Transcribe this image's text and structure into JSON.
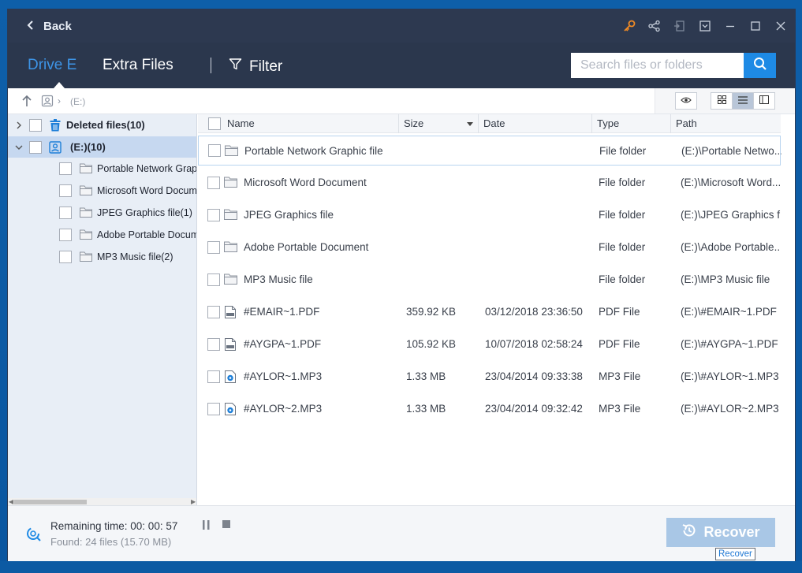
{
  "titlebar": {
    "back_label": "Back",
    "icons": [
      "key-icon",
      "share-icon",
      "exit-icon",
      "menu-dropdown-icon",
      "minimize-icon",
      "maximize-icon",
      "close-icon"
    ]
  },
  "tabs": [
    {
      "label": "Drive E",
      "active": true
    },
    {
      "label": "Extra Files",
      "active": false
    }
  ],
  "filter_label": "Filter",
  "search": {
    "placeholder": "Search files or folders",
    "value": ""
  },
  "breadcrumb": {
    "path": "(E:)"
  },
  "tree": {
    "items": [
      {
        "label": "Deleted files(10)",
        "expanded": false,
        "level": 0,
        "icon": "trash-icon"
      },
      {
        "label": "(E:)(10)",
        "expanded": true,
        "level": 0,
        "icon": "drive-icon",
        "selected": true
      },
      {
        "label": "Portable Network Graph",
        "level": 1,
        "icon": "folder-icon"
      },
      {
        "label": "Microsoft Word Docume",
        "level": 1,
        "icon": "folder-icon"
      },
      {
        "label": "JPEG Graphics file(1)",
        "level": 1,
        "icon": "folder-icon"
      },
      {
        "label": "Adobe Portable Docume",
        "level": 1,
        "icon": "folder-icon"
      },
      {
        "label": "MP3 Music file(2)",
        "level": 1,
        "icon": "folder-icon"
      }
    ]
  },
  "columns": {
    "name": "Name",
    "size": "Size",
    "date": "Date",
    "type": "Type",
    "path": "Path"
  },
  "files": [
    {
      "name": "Portable Network Graphic file",
      "size": "",
      "date": "",
      "type": "File folder",
      "path": "(E:)\\Portable Netwo...",
      "icon": "folder-icon"
    },
    {
      "name": "Microsoft Word Document",
      "size": "",
      "date": "",
      "type": "File folder",
      "path": "(E:)\\Microsoft Word...",
      "icon": "folder-icon"
    },
    {
      "name": "JPEG Graphics file",
      "size": "",
      "date": "",
      "type": "File folder",
      "path": "(E:)\\JPEG Graphics f...",
      "icon": "folder-icon"
    },
    {
      "name": "Adobe Portable Document",
      "size": "",
      "date": "",
      "type": "File folder",
      "path": "(E:)\\Adobe Portable...",
      "icon": "folder-icon"
    },
    {
      "name": "MP3 Music file",
      "size": "",
      "date": "",
      "type": "File folder",
      "path": "(E:)\\MP3 Music file",
      "icon": "folder-icon"
    },
    {
      "name": "#EMAIR~1.PDF",
      "size": "359.92 KB",
      "date": "03/12/2018 23:36:50",
      "type": "PDF File",
      "path": "(E:)\\#EMAIR~1.PDF",
      "icon": "pdf-file-icon"
    },
    {
      "name": "#AYGPA~1.PDF",
      "size": "105.92 KB",
      "date": "10/07/2018 02:58:24",
      "type": "PDF File",
      "path": "(E:)\\#AYGPA~1.PDF",
      "icon": "pdf-file-icon"
    },
    {
      "name": "#AYLOR~1.MP3",
      "size": "1.33 MB",
      "date": "23/04/2014 09:33:38",
      "type": "MP3 File",
      "path": "(E:)\\#AYLOR~1.MP3",
      "icon": "mp3-file-icon"
    },
    {
      "name": "#AYLOR~2.MP3",
      "size": "1.33 MB",
      "date": "23/04/2014 09:32:42",
      "type": "MP3 File",
      "path": "(E:)\\#AYLOR~2.MP3",
      "icon": "mp3-file-icon"
    }
  ],
  "status": {
    "remaining": "Remaining time: 00: 00: 57",
    "found": "Found: 24 files (15.70 MB)"
  },
  "recover": {
    "label": "Recover",
    "tooltip": "Recover"
  },
  "colors": {
    "accent": "#1e8ae5",
    "active_tab": "#3d94e6",
    "titlebar": "#2d3950",
    "recover_disabled": "#a9c7e6"
  }
}
